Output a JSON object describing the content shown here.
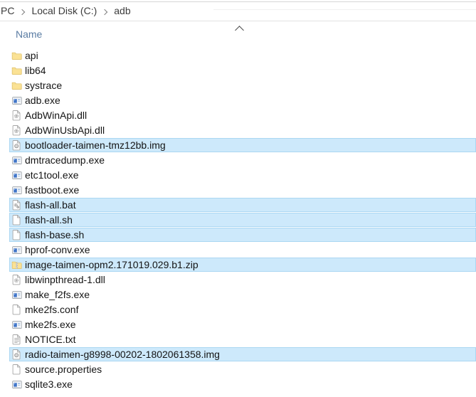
{
  "address_bar": {
    "crumbs": [
      "PC",
      "Local Disk (C:)",
      "adb"
    ]
  },
  "column_header": {
    "label": "Name",
    "sort_icon": "chevron-up-icon",
    "sort_direction": "ascending"
  },
  "colors": {
    "selection_fill": "#cde9fb",
    "selection_border": "#abd7f2",
    "header_text": "#5a7ca3",
    "folder_yellow": "#fbe295",
    "app_icon_blue": "#3f74c8"
  },
  "file_list": {
    "rows": [
      {
        "label": "api",
        "icon": "folder-icon",
        "selected": false
      },
      {
        "label": "lib64",
        "icon": "folder-icon",
        "selected": false
      },
      {
        "label": "systrace",
        "icon": "folder-icon",
        "selected": false
      },
      {
        "label": "adb.exe",
        "icon": "app-icon",
        "selected": false
      },
      {
        "label": "AdbWinApi.dll",
        "icon": "dll-icon",
        "selected": false
      },
      {
        "label": "AdbWinUsbApi.dll",
        "icon": "dll-icon",
        "selected": false
      },
      {
        "label": "bootloader-taimen-tmz12bb.img",
        "icon": "disc-image-icon",
        "selected": true
      },
      {
        "label": "dmtracedump.exe",
        "icon": "app-icon",
        "selected": false
      },
      {
        "label": "etc1tool.exe",
        "icon": "app-icon",
        "selected": false
      },
      {
        "label": "fastboot.exe",
        "icon": "app-icon",
        "selected": false
      },
      {
        "label": "flash-all.bat",
        "icon": "script-icon",
        "selected": true
      },
      {
        "label": "flash-all.sh",
        "icon": "doc-icon",
        "selected": true
      },
      {
        "label": "flash-base.sh",
        "icon": "doc-icon",
        "selected": true
      },
      {
        "label": "hprof-conv.exe",
        "icon": "app-icon",
        "selected": false
      },
      {
        "label": "image-taimen-opm2.171019.029.b1.zip",
        "icon": "zip-icon",
        "selected": true
      },
      {
        "label": "libwinpthread-1.dll",
        "icon": "dll-icon",
        "selected": false
      },
      {
        "label": "make_f2fs.exe",
        "icon": "app-icon",
        "selected": false
      },
      {
        "label": "mke2fs.conf",
        "icon": "doc-icon",
        "selected": false
      },
      {
        "label": "mke2fs.exe",
        "icon": "app-icon",
        "selected": false
      },
      {
        "label": "NOTICE.txt",
        "icon": "text-icon",
        "selected": false
      },
      {
        "label": "radio-taimen-g8998-00202-1802061358.img",
        "icon": "disc-image-icon",
        "selected": true
      },
      {
        "label": "source.properties",
        "icon": "doc-icon",
        "selected": false
      },
      {
        "label": "sqlite3.exe",
        "icon": "app-icon",
        "selected": false
      }
    ]
  }
}
